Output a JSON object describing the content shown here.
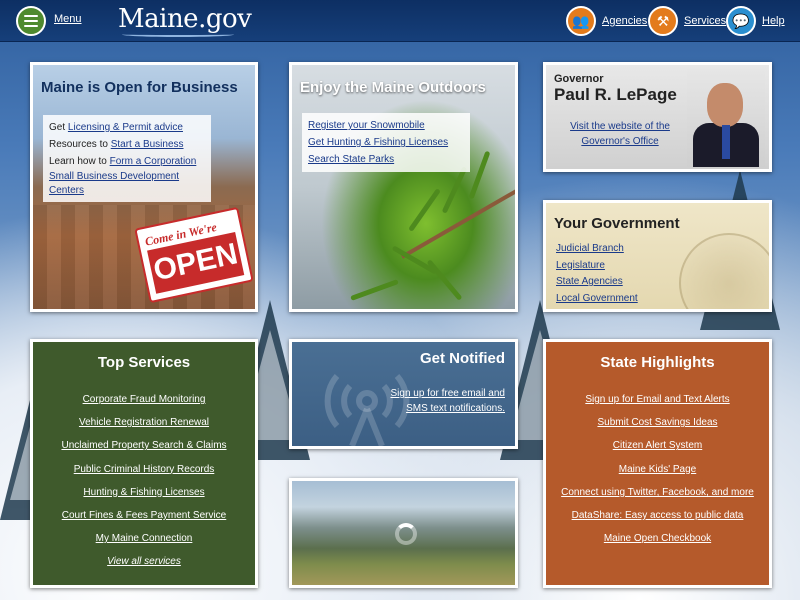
{
  "header": {
    "menu_label": "Menu",
    "logo": "Maine.gov",
    "agencies_label": "Agencies",
    "services_label": "Services",
    "help_label": "Help"
  },
  "business": {
    "title": "Maine is Open for Business",
    "lines": [
      {
        "prefix": "Get ",
        "link": "Licensing & Permit advice"
      },
      {
        "prefix": "Resources to ",
        "link": "Start a Business"
      },
      {
        "prefix": "Learn how to ",
        "link": "Form a Corporation"
      },
      {
        "prefix": "",
        "link": "Small Business Development Centers"
      }
    ],
    "sign_top": "Come in",
    "sign_top2": "We're",
    "sign_big": "OPEN"
  },
  "outdoors": {
    "title": "Enjoy the Maine Outdoors",
    "links": [
      "Register your Snowmobile",
      "Get Hunting & Fishing Licenses",
      "Search State Parks"
    ]
  },
  "governor": {
    "label": "Governor",
    "name": "Paul R. LePage",
    "link": "Visit the website of the Governor's Office"
  },
  "government": {
    "title": "Your Government",
    "links": [
      "Judicial Branch",
      "Legislature",
      "State Agencies",
      "Local Government"
    ]
  },
  "services": {
    "title": "Top Services",
    "links": [
      "Corporate Fraud Monitoring",
      "Vehicle Registration Renewal",
      "Unclaimed Property Search & Claims",
      "Public Criminal History Records",
      "Hunting & Fishing Licenses",
      "Court Fines & Fees Payment Service",
      "My Maine Connection"
    ],
    "view_all": "View all services"
  },
  "notified": {
    "title": "Get Notified",
    "link": "Sign up for free email and SMS text notifications."
  },
  "highlights": {
    "title": "State Highlights",
    "links": [
      "Sign up for Email and Text Alerts",
      "Submit Cost Savings Ideas",
      "Citizen Alert System",
      "Maine Kids' Page",
      "Connect using Twitter, Facebook, and more",
      "DataShare: Easy access to public data",
      "Maine Open Checkbook"
    ]
  },
  "icons": {
    "menu": "menu-icon",
    "agencies": "people-icon",
    "services": "tools-icon",
    "help": "chat-bubble-icon",
    "notify": "broadcast-tower-icon",
    "loading": "loading-spinner-icon"
  },
  "colors": {
    "header": "#0d2f63",
    "services_bg": "#3f5a2c",
    "highlights_bg": "#b55a2b",
    "notified_bg": "#4a6f94",
    "agencies_icon": "#e37b1c",
    "help_icon": "#2a8fd0",
    "menu_icon": "#4f8a2f"
  }
}
